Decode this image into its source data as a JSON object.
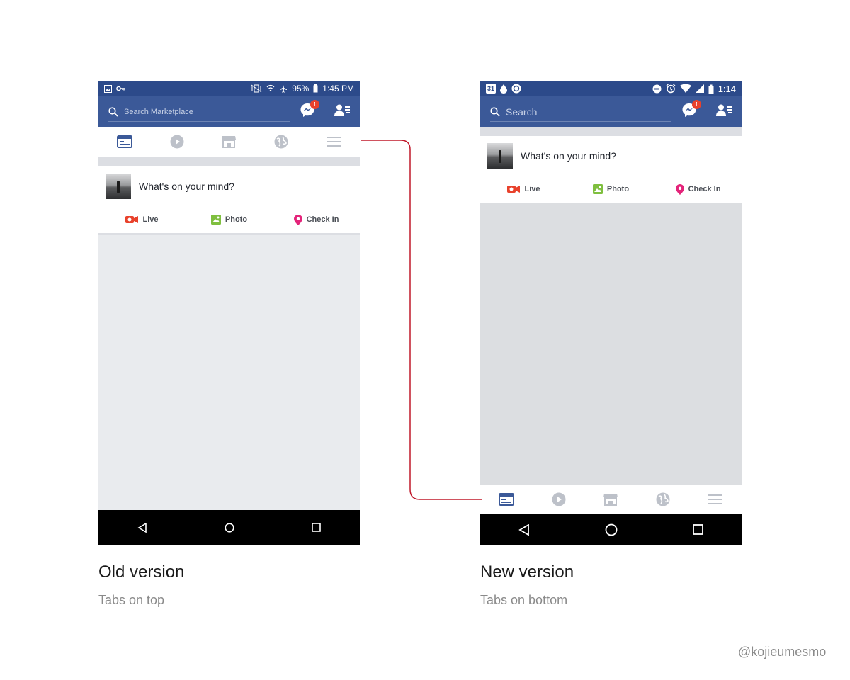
{
  "old_version": {
    "status_bar": {
      "battery": "95%",
      "time": "1:45 PM"
    },
    "search": {
      "placeholder": "Search Marketplace"
    },
    "messenger_badge": "1",
    "tabs": [
      {
        "icon": "news-feed-icon",
        "active": true
      },
      {
        "icon": "video-icon",
        "active": false
      },
      {
        "icon": "marketplace-icon",
        "active": false
      },
      {
        "icon": "notifications-globe-icon",
        "active": false
      },
      {
        "icon": "menu-icon",
        "active": false
      }
    ],
    "composer": {
      "prompt": "What's on your mind?",
      "actions": [
        {
          "label": "Live",
          "icon": "live-video-icon",
          "color": "#e8412b"
        },
        {
          "label": "Photo",
          "icon": "photo-icon",
          "color": "#7fbf3f"
        },
        {
          "label": "Check In",
          "icon": "check-in-pin-icon",
          "color": "#e4247a"
        }
      ]
    },
    "caption": {
      "title": "Old version",
      "subtitle": "Tabs on top"
    }
  },
  "new_version": {
    "status_bar": {
      "time": "1:14",
      "calendar_day": "31"
    },
    "search": {
      "placeholder": "Search"
    },
    "messenger_badge": "1",
    "tabs": [
      {
        "icon": "news-feed-icon",
        "active": true
      },
      {
        "icon": "video-icon",
        "active": false
      },
      {
        "icon": "marketplace-icon",
        "active": false
      },
      {
        "icon": "notifications-globe-icon",
        "active": false
      },
      {
        "icon": "menu-icon",
        "active": false
      }
    ],
    "composer": {
      "prompt": "What's on your mind?",
      "actions": [
        {
          "label": "Live",
          "icon": "live-video-icon",
          "color": "#e8412b"
        },
        {
          "label": "Photo",
          "icon": "photo-icon",
          "color": "#7fbf3f"
        },
        {
          "label": "Check In",
          "icon": "check-in-pin-icon",
          "color": "#e4247a"
        }
      ]
    },
    "caption": {
      "title": "New version",
      "subtitle": "Tabs on bottom"
    }
  },
  "credit": "@kojieumesmo",
  "colors": {
    "facebook_blue": "#3b5998",
    "status_bar": "#2c4a8a",
    "active_tab": "#3b5998",
    "inactive_tab": "#bdc1c9",
    "feed_background": "#e9ebee",
    "connector_line": "#c0182a"
  }
}
